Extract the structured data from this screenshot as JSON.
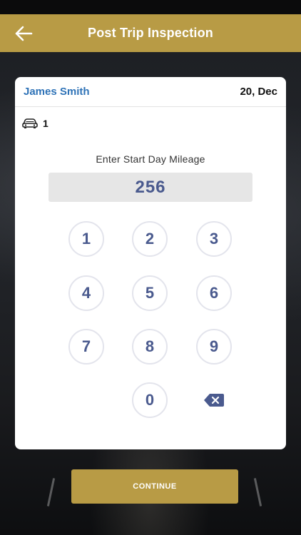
{
  "header": {
    "title": "Post Trip Inspection",
    "back_icon": "arrow-left-icon"
  },
  "card": {
    "driver_name": "James Smith",
    "date": "20, Dec",
    "vehicle_icon": "car-icon",
    "vehicle_count": "1",
    "prompt": "Enter Start Day Mileage",
    "mileage_value": "256"
  },
  "keypad": {
    "keys": [
      "1",
      "2",
      "3",
      "4",
      "5",
      "6",
      "7",
      "8",
      "9",
      "0"
    ],
    "backspace_icon": "backspace-icon"
  },
  "footer": {
    "continue_label": "CONTINUE"
  },
  "colors": {
    "accent": "#b89b45",
    "name_blue": "#2f73b7",
    "keypad_text": "#4a5a8e"
  }
}
